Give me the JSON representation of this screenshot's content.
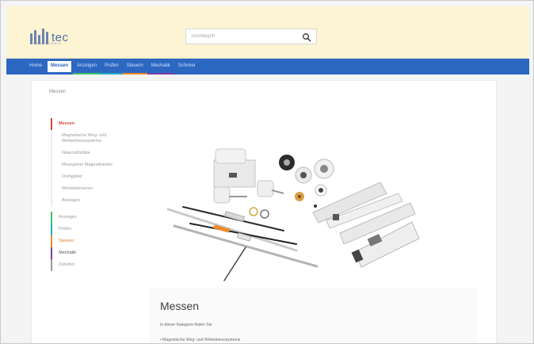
{
  "brand": {
    "logo_text": "tec",
    "logo_sub": "MESSTECHNIK",
    "primary": "#2c67c2",
    "header_bg": "#fdf4d4"
  },
  "search": {
    "placeholder": "Suchbegriff",
    "icon": "search-icon"
  },
  "nav": {
    "items": [
      {
        "label": "Home",
        "color": "#cfe0fb"
      },
      {
        "label": "Messen",
        "color": "#2c67c2",
        "active": true
      },
      {
        "label": "Anzeigen",
        "color": "#3fbf6a"
      },
      {
        "label": "Prüfen",
        "color": "#28a7c8"
      },
      {
        "label": "Steuern",
        "color": "#f08a2b"
      },
      {
        "label": "Mechatik",
        "color": "#7b3da6"
      },
      {
        "label": "Schmier",
        "color": "#cfe0fb"
      }
    ]
  },
  "breadcrumb": "Messen",
  "sidebar": {
    "items": [
      {
        "label": "Messen",
        "active": true,
        "color": "#d8453a",
        "level": 1
      },
      {
        "label": "Magnetische Weg- und Winkelmesssysteme",
        "level": 2
      },
      {
        "label": "Glasmaßstäbe",
        "level": 2
      },
      {
        "label": "Messgeber Magnetbänder",
        "level": 2
      },
      {
        "label": "Drehgeber",
        "level": 2
      },
      {
        "label": "Winkelsensoren",
        "level": 2
      },
      {
        "label": "Anzeigen",
        "level": 2
      },
      {
        "label": "Anzeigen",
        "level": 1,
        "color": "#3fbf6a"
      },
      {
        "label": "Prüfen",
        "level": 1,
        "color": "#28a7c8"
      },
      {
        "label": "Steuern",
        "level": 1,
        "color": "#f08a2b"
      },
      {
        "label": "Mechatik",
        "level": 1,
        "color": "#7b3da6"
      },
      {
        "label": "Zubehör",
        "level": 1,
        "color": "#999999"
      }
    ]
  },
  "main": {
    "title": "Messen",
    "intro": "In dieser Kategorie finden Sie",
    "bullets": [
      "Magnetische Weg- und Winkelmesssysteme"
    ]
  }
}
